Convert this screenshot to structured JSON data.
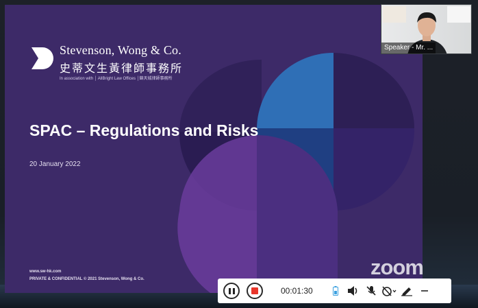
{
  "slide": {
    "logo_en": "Stevenson, Wong & Co.",
    "logo_zh": "史蒂文生黃律師事務所",
    "association": "In association with │ AllBright Law Offices │錦天城律師事務所",
    "title": "SPAC – Regulations and Risks",
    "date": "20 January 2022",
    "website": "www.sw-hk.com",
    "confidential": "PRIVATE & CONFIDENTIAL © 2021 Stevenson, Wong & Co."
  },
  "speaker": {
    "label": "Speaker - Mr. ..."
  },
  "zoom_logo": "zoom",
  "controls": {
    "timer": "00:01:30",
    "icons": [
      "pause-icon",
      "stop-icon",
      "battery-icon",
      "speaker-volume-icon",
      "microphone-muted-icon",
      "alarm-muted-icon",
      "annotate-pen-icon",
      "minimize-icon"
    ]
  },
  "colors": {
    "slide_bg": "#3d2a68",
    "accent_blue": "#2e6fb8",
    "accent_purple": "#6a3c9c",
    "record_stop": "#e8352a"
  }
}
